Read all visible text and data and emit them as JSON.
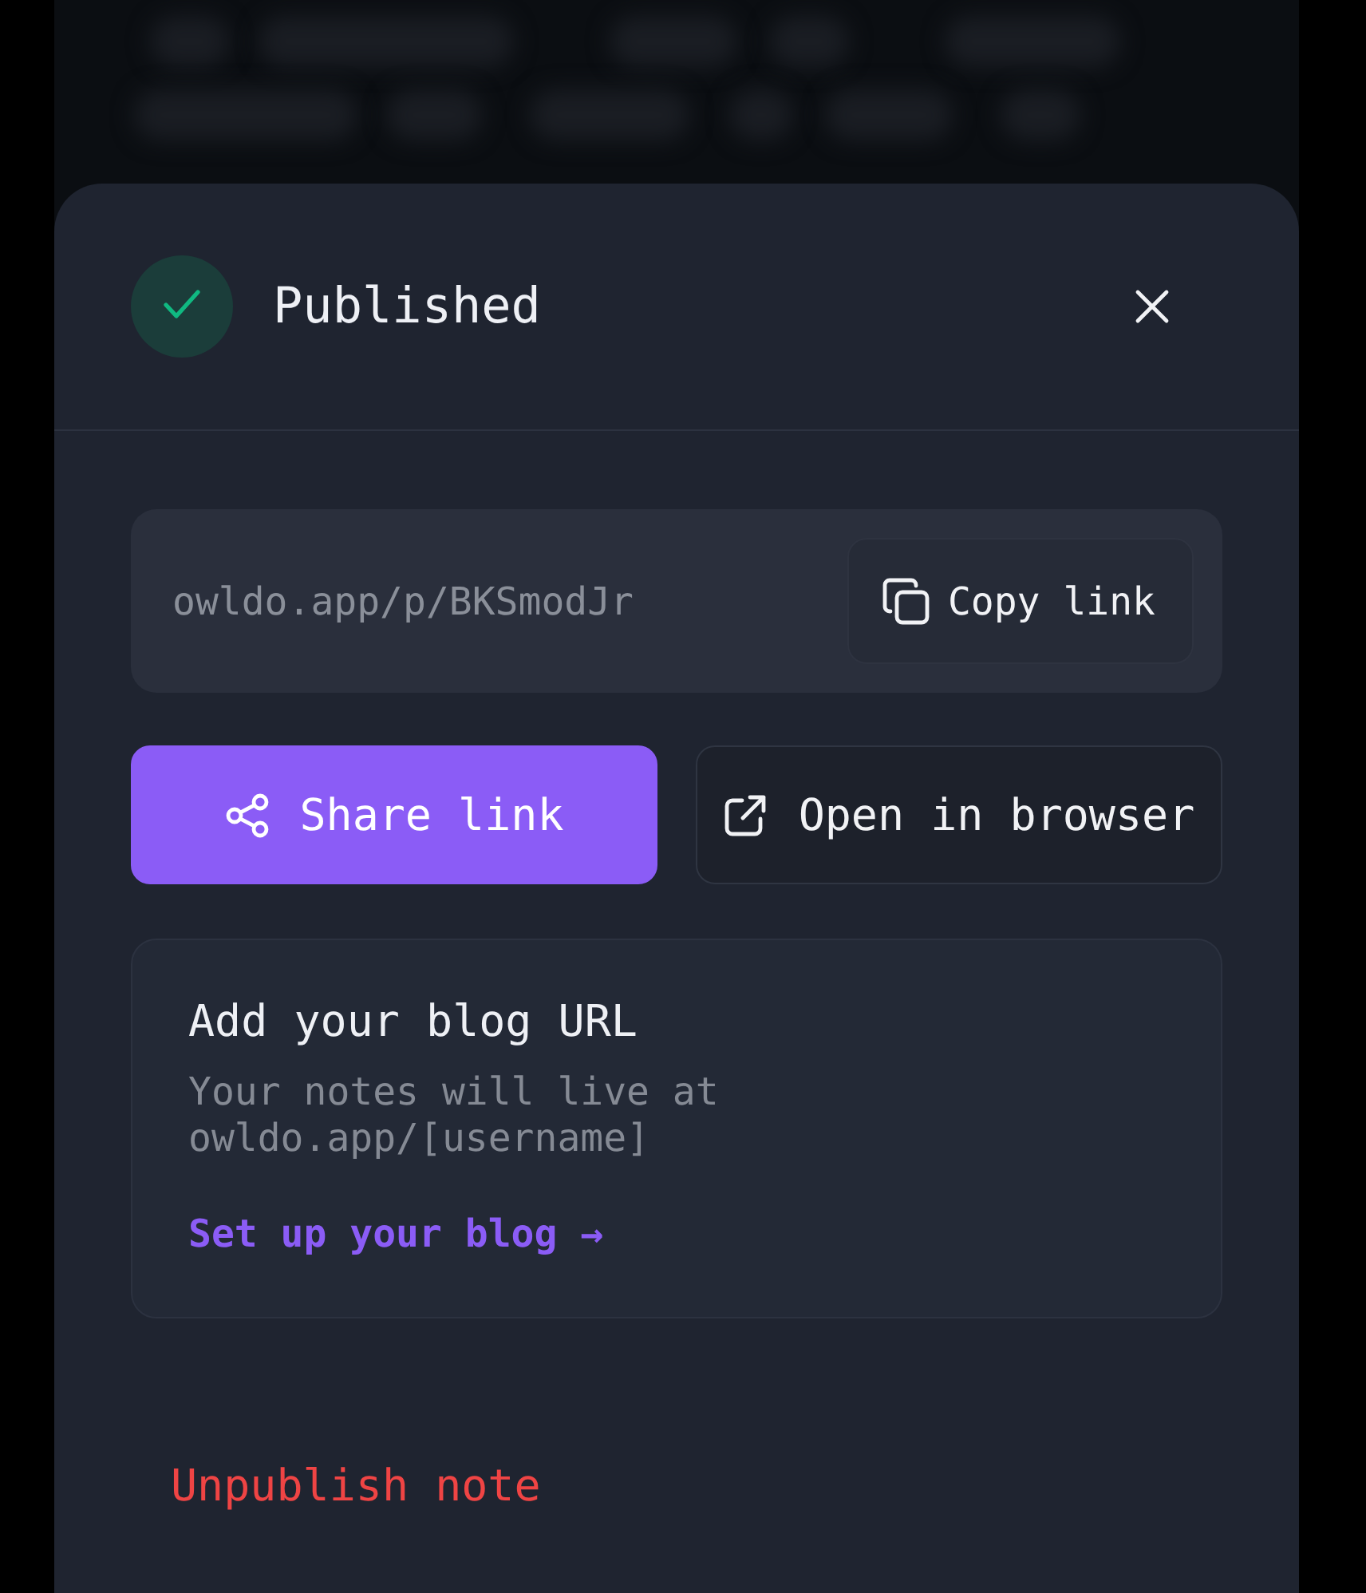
{
  "header": {
    "title": "Published"
  },
  "link_panel": {
    "url": "owldo.app/p/BKSmodJr",
    "copy_button": "Copy link"
  },
  "actions": [
    {
      "label": "Share link",
      "kind": "primary"
    },
    {
      "label": "Open in browser",
      "kind": "secondary"
    }
  ],
  "blog_card": {
    "title": "Add your blog URL",
    "description": "Your notes will live at owldo.app/[username]",
    "link": "Set up your blog →"
  },
  "unpublish_button": "Unpublish note"
}
